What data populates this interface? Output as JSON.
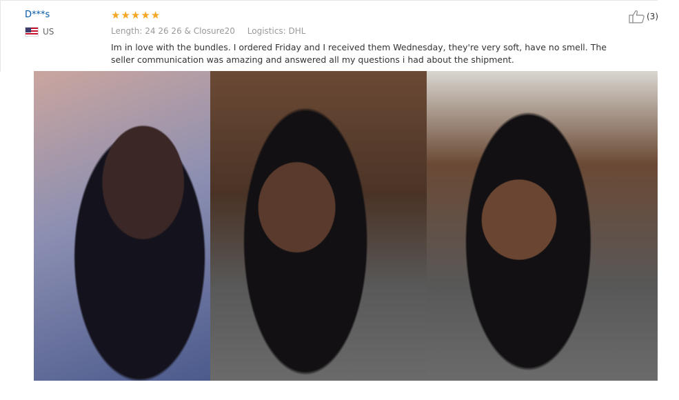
{
  "reviewer": {
    "name": "D***s",
    "country": "US",
    "flag_icon": "us-flag-icon"
  },
  "rating": {
    "stars": 5,
    "max": 5,
    "star_icon": "star-icon",
    "color": "#f5a623"
  },
  "attributes": {
    "length_label": "Length:",
    "length_value": "24 26 26 & Closure20",
    "logistics_label": "Logistics:",
    "logistics_value": "DHL"
  },
  "review_text": "Im in love with the bundles. I ordered Friday and I received them Wednesday, they're very soft, have no smell. The seller communication was amazing and answered all my questions i had about the shipment.",
  "helpful": {
    "icon": "thumbs-up-icon",
    "count": "(3)"
  },
  "colors": {
    "username": "#0057a8",
    "muted": "#999999",
    "text": "#333333"
  }
}
